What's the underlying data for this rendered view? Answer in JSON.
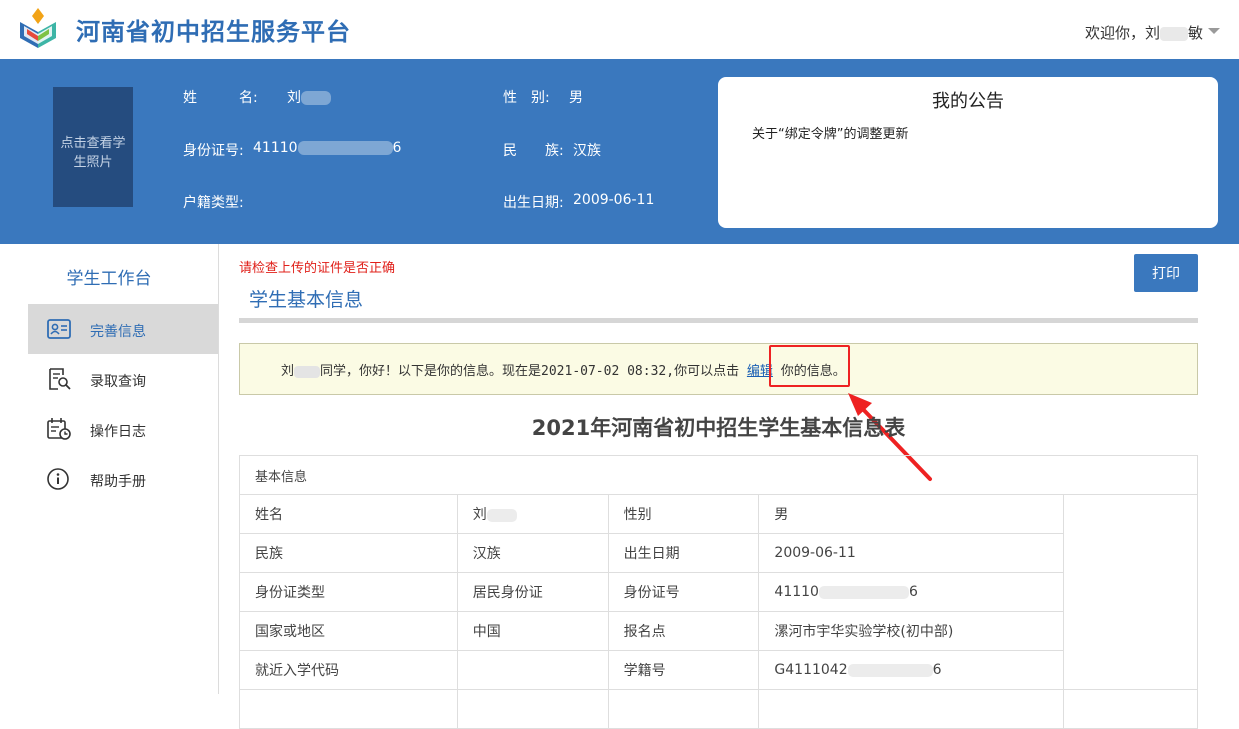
{
  "header": {
    "site_title": "河南省初中招生服务平台",
    "welcome_prefix": "欢迎你，",
    "welcome_name_visible": "刘",
    "welcome_name_tail": "敏"
  },
  "profile": {
    "photo_text": "点击查看学生照片",
    "name_label": "姓　　　名:",
    "name_value": "刘",
    "gender_label": "性　别:",
    "gender_value": "男",
    "id_label": "身份证号:",
    "id_value_start": "41110",
    "id_value_end": "6",
    "ethnicity_label": "民　　族:",
    "ethnicity_value": "汉族",
    "household_label": "户籍类型:",
    "household_value": "",
    "birth_label": "出生日期:",
    "birth_value": "2009-06-11"
  },
  "notice": {
    "title": "我的公告",
    "items": [
      "关于“绑定令牌”的调整更新"
    ]
  },
  "sidebar": {
    "title": "学生工作台",
    "items": [
      {
        "label": "完善信息",
        "icon": "id-card-icon",
        "active": true
      },
      {
        "label": "录取查询",
        "icon": "document-search-icon",
        "active": false
      },
      {
        "label": "操作日志",
        "icon": "calendar-clock-icon",
        "active": false
      },
      {
        "label": "帮助手册",
        "icon": "info-icon",
        "active": false
      }
    ]
  },
  "main": {
    "warning": "请检查上传的证件是否正确",
    "print_label": "打印",
    "section_title": "学生基本信息",
    "tip": {
      "name": "刘",
      "part1": "同学，你好！以下是你的信息。现在是2021-07-02 08:32,你可以点击 ",
      "link": "编辑",
      "part2": " 你的信息。"
    },
    "table_title": "2021年河南省初中招生学生基本信息表",
    "table_group": "基本信息",
    "rows": [
      [
        "姓名",
        "刘",
        "性别",
        "男"
      ],
      [
        "民族",
        "汉族",
        "出生日期",
        "2009-06-11"
      ],
      [
        "身份证类型",
        "居民身份证",
        "身份证号",
        "41110"
      ],
      [
        "国家或地区",
        "中国",
        "报名点",
        "漯河市宇华实验学校(初中部)"
      ],
      [
        "就近入学代码",
        "",
        "学籍号",
        "G4111042"
      ]
    ],
    "row_tails": {
      "id_tail": "6",
      "xueji_tail": "6"
    }
  },
  "colors": {
    "brand_blue": "#3a78be",
    "title_blue": "#2f6db4",
    "warning_red": "#e0201a",
    "tip_bg": "#fbfbe4",
    "highlight_red": "#e22"
  }
}
